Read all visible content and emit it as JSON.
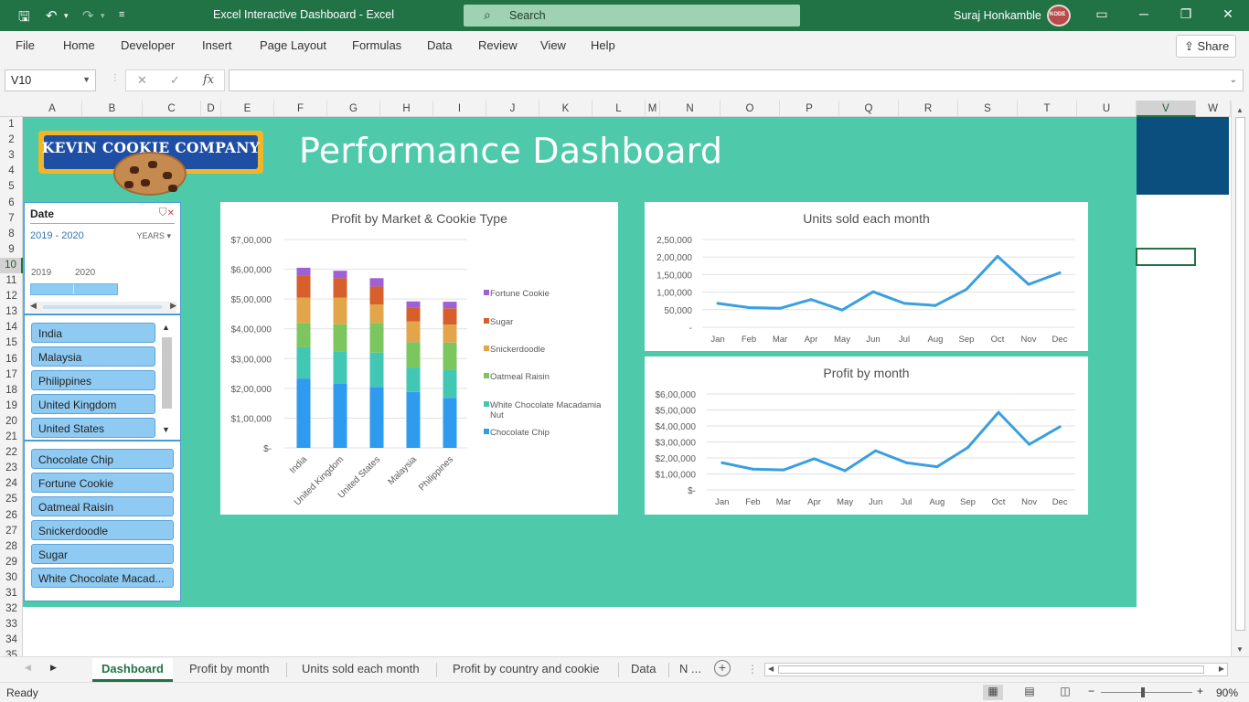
{
  "titlebar": {
    "window_title": "Excel Interactive Dashboard  -  Excel",
    "search_placeholder": "Search",
    "user_name": "Suraj Honkamble",
    "avatar_label": "KODE"
  },
  "ribbon": {
    "tabs": [
      "File",
      "Home",
      "Developer",
      "Insert",
      "Page Layout",
      "Formulas",
      "Data",
      "Review",
      "View",
      "Help"
    ],
    "share_label": "Share"
  },
  "formula_bar": {
    "name_box": "V10",
    "formula": "",
    "fx": "fx"
  },
  "grid": {
    "columns": [
      "A",
      "B",
      "C",
      "D",
      "E",
      "F",
      "G",
      "H",
      "I",
      "J",
      "K",
      "L",
      "M",
      "N",
      "O",
      "P",
      "Q",
      "R",
      "S",
      "T",
      "U",
      "V",
      "W"
    ],
    "rows": [
      "1",
      "2",
      "3",
      "4",
      "5",
      "6",
      "7",
      "8",
      "9",
      "10",
      "11",
      "12",
      "13",
      "14",
      "15",
      "16",
      "17",
      "18",
      "19",
      "20",
      "21",
      "22",
      "23",
      "24",
      "25",
      "26",
      "27",
      "28",
      "29",
      "30",
      "31",
      "32",
      "33",
      "34",
      "35"
    ],
    "selected_col": "V",
    "selected_row": "10"
  },
  "dashboard": {
    "logo_text": "KEVIN COOKIE COMPANY",
    "title": "Performance Dashboard",
    "colors": {
      "background": "#4ecaab",
      "blue_panel": "#0b4f7f",
      "line": "#3a9fe0"
    }
  },
  "timeline": {
    "header": "Date",
    "range": "2019 - 2020",
    "level": "YEARS",
    "years": [
      "2019",
      "2020"
    ]
  },
  "country_slicer": {
    "items": [
      "India",
      "Malaysia",
      "Philippines",
      "United Kingdom",
      "United States"
    ]
  },
  "cookie_slicer": {
    "items": [
      "Chocolate Chip",
      "Fortune Cookie",
      "Oatmeal Raisin",
      "Snickerdoodle",
      "Sugar",
      "White Chocolate Macad..."
    ]
  },
  "chart_data": [
    {
      "type": "bar",
      "stacked": true,
      "title": "Profit by Market & Cookie Type",
      "categories": [
        "India",
        "United Kingdom",
        "United States",
        "Malaysia",
        "Philippines"
      ],
      "y_ticks": [
        "$-",
        "$1,00,000",
        "$2,00,000",
        "$3,00,000",
        "$4,00,000",
        "$5,00,000",
        "$6,00,000",
        "$7,00,000"
      ],
      "ylim": [
        0,
        700000
      ],
      "grid": true,
      "legend_position": "right",
      "series": [
        {
          "name": "Chocolate Chip",
          "color": "#2e9bef",
          "values": [
            233000,
            215000,
            205000,
            188000,
            168000
          ]
        },
        {
          "name": "White Chocolate Macadamia Nut",
          "color": "#42c7b5",
          "values": [
            105000,
            110000,
            115000,
            82000,
            93000
          ]
        },
        {
          "name": "Oatmeal Raisin",
          "color": "#7cc660",
          "values": [
            82000,
            90000,
            100000,
            85000,
            93000
          ]
        },
        {
          "name": "Snickerdoodle",
          "color": "#e3a54a",
          "values": [
            85000,
            90000,
            62000,
            70000,
            60000
          ]
        },
        {
          "name": "Sugar",
          "color": "#d65f2c",
          "values": [
            75000,
            65000,
            60000,
            45000,
            55000
          ]
        },
        {
          "name": "Fortune Cookie",
          "color": "#9f60d6",
          "values": [
            25000,
            25000,
            28000,
            22000,
            22000
          ]
        }
      ]
    },
    {
      "type": "line",
      "title": "Units sold each month",
      "categories": [
        "Jan",
        "Feb",
        "Mar",
        "Apr",
        "May",
        "Jun",
        "Jul",
        "Aug",
        "Sep",
        "Oct",
        "Nov",
        "Dec"
      ],
      "y_ticks": [
        "-",
        "50,000",
        "1,00,000",
        "1,50,000",
        "2,00,000",
        "2,50,000"
      ],
      "ylim": [
        0,
        250000
      ],
      "grid": true,
      "series": [
        {
          "name": "",
          "values": [
            68000,
            56000,
            54000,
            79000,
            49000,
            101000,
            68000,
            62000,
            108000,
            202000,
            122000,
            155000
          ]
        }
      ]
    },
    {
      "type": "line",
      "title": "Profit by month",
      "categories": [
        "Jan",
        "Feb",
        "Mar",
        "Apr",
        "May",
        "Jun",
        "Jul",
        "Aug",
        "Sep",
        "Oct",
        "Nov",
        "Dec"
      ],
      "y_ticks": [
        "$-",
        "$1,00,000",
        "$2,00,000",
        "$3,00,000",
        "$4,00,000",
        "$5,00,000",
        "$6,00,000"
      ],
      "ylim": [
        0,
        600000
      ],
      "grid": true,
      "series": [
        {
          "name": "",
          "values": [
            170000,
            130000,
            125000,
            195000,
            120000,
            245000,
            170000,
            145000,
            265000,
            485000,
            285000,
            395000
          ]
        }
      ]
    }
  ],
  "sheet_tabs": {
    "active": "Dashboard",
    "tabs": [
      "Profit by month",
      "Units sold each month",
      "Profit by country and cookie",
      "Data",
      "N ..."
    ]
  },
  "status_bar": {
    "status": "Ready",
    "zoom": "90%"
  }
}
